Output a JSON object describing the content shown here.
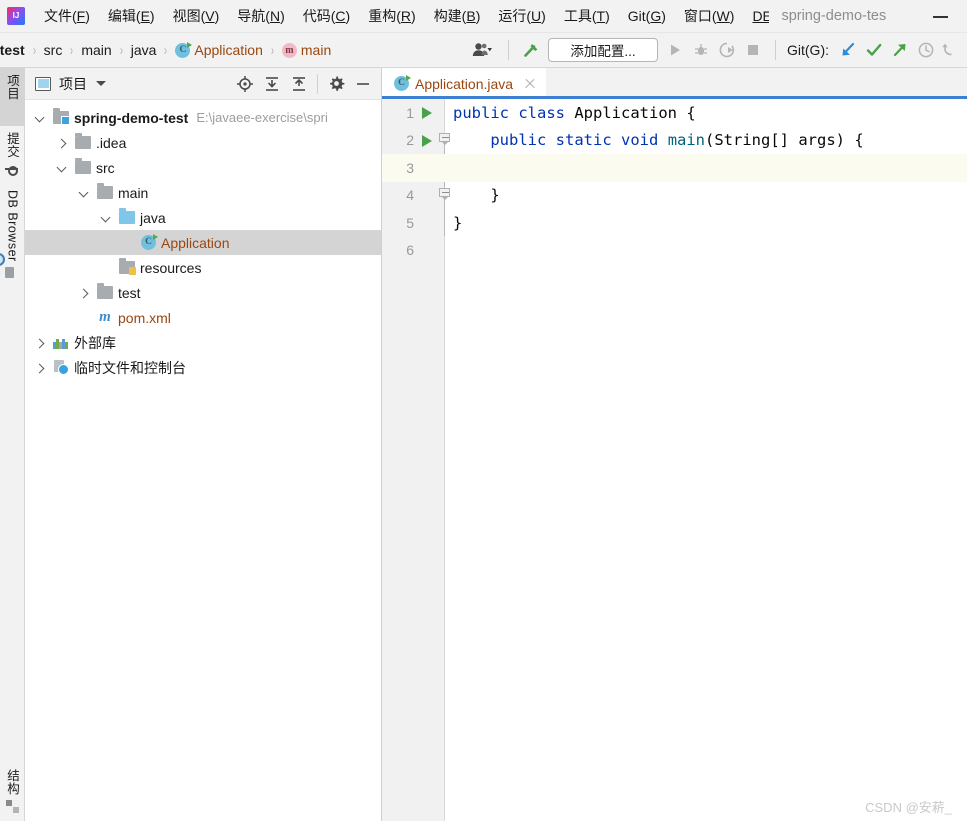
{
  "window": {
    "title": "spring-demo-tes",
    "app_icon": "intellij-idea-logo",
    "minimize_icon": "minimize-icon"
  },
  "menubar": {
    "items": [
      {
        "label": "文件(F)",
        "mnemonic": "F"
      },
      {
        "label": "编辑(E)",
        "mnemonic": "E"
      },
      {
        "label": "视图(V)",
        "mnemonic": "V"
      },
      {
        "label": "导航(N)",
        "mnemonic": "N"
      },
      {
        "label": "代码(C)",
        "mnemonic": "C"
      },
      {
        "label": "重构(R)",
        "mnemonic": "R"
      },
      {
        "label": "构建(B)",
        "mnemonic": "B"
      },
      {
        "label": "运行(U)",
        "mnemonic": "U"
      },
      {
        "label": "工具(T)",
        "mnemonic": "T"
      },
      {
        "label": "Git(G)",
        "mnemonic": "G"
      },
      {
        "label": "窗口(W)",
        "mnemonic": "W"
      },
      {
        "label": "DE",
        "mnemonic": "D"
      }
    ]
  },
  "navbar": {
    "breadcrumbs": [
      {
        "label": "no-test",
        "icon": "",
        "kind": "root"
      },
      {
        "label": "src",
        "icon": "",
        "kind": "plain"
      },
      {
        "label": "main",
        "icon": "",
        "kind": "plain"
      },
      {
        "label": "java",
        "icon": "",
        "kind": "plain"
      },
      {
        "label": "Application",
        "icon": "class-icon",
        "kind": "code"
      },
      {
        "label": "main",
        "icon": "method-icon",
        "kind": "code"
      }
    ],
    "separator": "›",
    "toolbar": {
      "vcs_user_icon": "user-group-icon",
      "build_icon": "build-hammer-icon",
      "run_config_label": "添加配置...",
      "run_icon": "run-icon",
      "debug_icon": "debug-icon",
      "coverage_icon": "run-with-coverage-icon",
      "stop_icon": "stop-icon",
      "git_label": "Git(G):",
      "update_icon": "vcs-update-icon",
      "commit_icon": "vcs-commit-icon",
      "push_icon": "vcs-push-icon",
      "history_icon": "vcs-history-icon",
      "rollback_icon": "vcs-rollback-icon"
    }
  },
  "stripe": {
    "top_buttons": [
      {
        "label": "项目",
        "icon": "project-folder-icon",
        "active": true
      },
      {
        "label": "提交",
        "icon": "commit-icon",
        "active": false
      },
      {
        "label": "DB Browser",
        "icon": "db-browser-icon",
        "active": false
      }
    ],
    "bottom_buttons": [
      {
        "label": "结构",
        "icon": "structure-icon",
        "active": false
      }
    ]
  },
  "project_panel": {
    "header": {
      "icon": "project-view-icon",
      "title": "项目",
      "dropdown_icon": "chevron-down-icon",
      "actions": [
        {
          "name": "locate-icon"
        },
        {
          "name": "expand-all-icon"
        },
        {
          "name": "collapse-all-icon"
        },
        {
          "name": "settings-gear-icon"
        },
        {
          "name": "hide-panel-icon"
        }
      ]
    },
    "tree": [
      {
        "label": "spring-demo-test",
        "path": "E:\\javaee-exercise\\spri",
        "indent": 0,
        "arrow": "expanded",
        "icon": "module-folder-icon",
        "style": "bold",
        "selected": false
      },
      {
        "label": ".idea",
        "path": "",
        "indent": 1,
        "arrow": "collapsed",
        "icon": "folder-icon",
        "style": "plain",
        "selected": false
      },
      {
        "label": "src",
        "path": "",
        "indent": 1,
        "arrow": "expanded",
        "icon": "folder-icon",
        "style": "plain",
        "selected": false
      },
      {
        "label": "main",
        "path": "",
        "indent": 2,
        "arrow": "expanded",
        "icon": "folder-icon",
        "style": "plain",
        "selected": false
      },
      {
        "label": "java",
        "path": "",
        "indent": 3,
        "arrow": "expanded",
        "icon": "source-folder-icon",
        "style": "plain",
        "selected": false
      },
      {
        "label": "Application",
        "path": "",
        "indent": 4,
        "arrow": "none",
        "icon": "class-icon",
        "style": "code",
        "selected": true
      },
      {
        "label": "resources",
        "path": "",
        "indent": 3,
        "arrow": "none",
        "icon": "resources-folder-icon",
        "style": "plain",
        "selected": false
      },
      {
        "label": "test",
        "path": "",
        "indent": 2,
        "arrow": "collapsed",
        "icon": "folder-icon",
        "style": "plain",
        "selected": false
      },
      {
        "label": "pom.xml",
        "path": "",
        "indent": 2,
        "arrow": "none",
        "icon": "maven-icon",
        "style": "code",
        "selected": false
      },
      {
        "label": "外部库",
        "path": "",
        "indent": 0,
        "arrow": "collapsed",
        "icon": "library-icon",
        "style": "plain",
        "selected": false
      },
      {
        "label": "临时文件和控制台",
        "path": "",
        "indent": 0,
        "arrow": "collapsed",
        "icon": "scratches-icon",
        "style": "plain",
        "selected": false
      }
    ]
  },
  "editor": {
    "tabs": [
      {
        "label": "Application.java",
        "icon": "class-icon",
        "active": true,
        "close_icon": "close-icon"
      }
    ],
    "code_lines": [
      {
        "num": "1",
        "indent": 0,
        "current": false,
        "run_marker": true,
        "fold": "none",
        "tokens": [
          {
            "t": "public",
            "c": "kw"
          },
          {
            "t": " ",
            "c": "plain"
          },
          {
            "t": "class",
            "c": "kw"
          },
          {
            "t": " Application {",
            "c": "plain"
          }
        ]
      },
      {
        "num": "2",
        "indent": 0,
        "current": false,
        "run_marker": true,
        "fold": "start",
        "tokens": [
          {
            "t": "    ",
            "c": "plain"
          },
          {
            "t": "public",
            "c": "kw"
          },
          {
            "t": " ",
            "c": "plain"
          },
          {
            "t": "static",
            "c": "kw"
          },
          {
            "t": " ",
            "c": "plain"
          },
          {
            "t": "void",
            "c": "kw"
          },
          {
            "t": " ",
            "c": "plain"
          },
          {
            "t": "main",
            "c": "mthd"
          },
          {
            "t": "(String[] args) {",
            "c": "plain"
          }
        ]
      },
      {
        "num": "3",
        "indent": 0,
        "current": true,
        "run_marker": false,
        "fold": "none",
        "tokens": [
          {
            "t": "",
            "c": "plain"
          }
        ]
      },
      {
        "num": "4",
        "indent": 0,
        "current": false,
        "run_marker": false,
        "fold": "end",
        "tokens": [
          {
            "t": "    }",
            "c": "plain"
          }
        ]
      },
      {
        "num": "5",
        "indent": 0,
        "current": false,
        "run_marker": false,
        "fold": "none",
        "tokens": [
          {
            "t": "}",
            "c": "plain"
          }
        ]
      },
      {
        "num": "6",
        "indent": 0,
        "current": false,
        "run_marker": false,
        "fold": "none",
        "tokens": [
          {
            "t": "",
            "c": "plain"
          }
        ]
      }
    ]
  },
  "watermark": {
    "text": "CSDN @安菥_"
  },
  "colors": {
    "accent_blue": "#3d7fd1",
    "keyword_blue": "#0033b3",
    "method_teal": "#00627a",
    "code_orange": "#9a4710",
    "selection_gray": "#d4d4d4",
    "current_line": "#fcfbef",
    "run_green": "#4aa14a",
    "toolbar_bg": "#f2f2f2"
  }
}
